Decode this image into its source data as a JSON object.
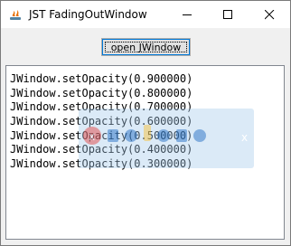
{
  "window": {
    "title": "JST FadingOutWindow",
    "controls": {
      "minimize": "minimize-icon",
      "maximize": "maximize-icon",
      "close": "close-icon"
    }
  },
  "toolbar": {
    "open_button_label": "open JWindow"
  },
  "log": {
    "lines": [
      "JWindow.setOpacity(0.900000)",
      "JWindow.setOpacity(0.800000)",
      "JWindow.setOpacity(0.700000)",
      "JWindow.setOpacity(0.600000)",
      "JWindow.setOpacity(0.500000)",
      "JWindow.setOpacity(0.400000)",
      "JWindow.setOpacity(0.300000)"
    ]
  },
  "fading_window": {
    "close_label": "x",
    "opacity": 0.3,
    "tint": "#a0c8eb"
  },
  "colors": {
    "accent": "#0078d7",
    "logo_red": "#e53935",
    "logo_blue": "#1565c0",
    "logo_yellow": "#fbc02d"
  }
}
